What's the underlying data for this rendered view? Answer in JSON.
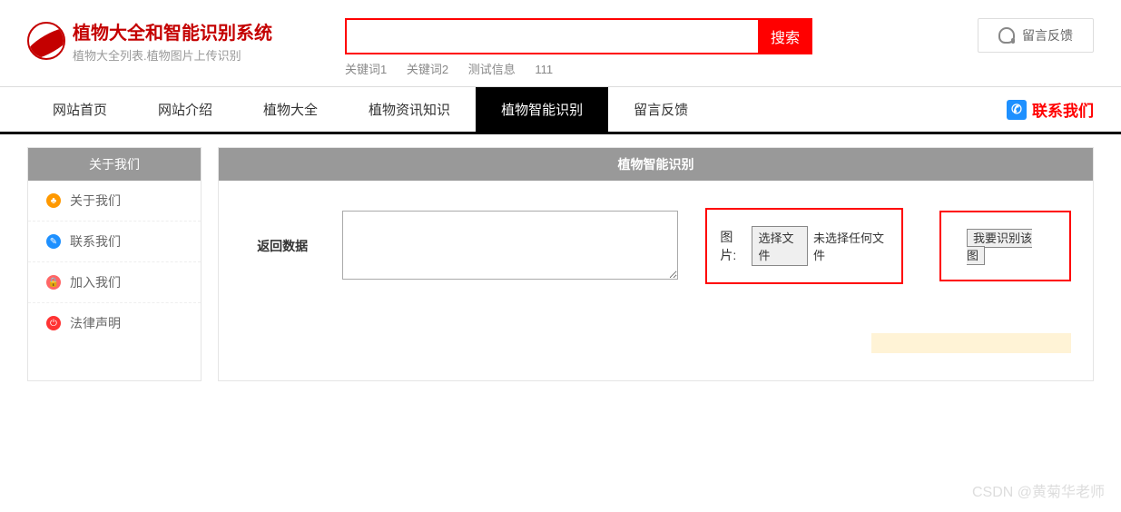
{
  "header": {
    "title": "植物大全和智能识别系统",
    "subtitle": "植物大全列表.植物图片上传识别",
    "search_button": "搜索",
    "keywords": [
      "关键词1",
      "关键词2",
      "测试信息",
      "111"
    ],
    "feedback_label": "留言反馈"
  },
  "nav": {
    "items": [
      "网站首页",
      "网站介绍",
      "植物大全",
      "植物资讯知识",
      "植物智能识别",
      "留言反馈"
    ],
    "active_index": 4,
    "contact_label": "联系我们"
  },
  "sidebar": {
    "header": "关于我们",
    "items": [
      {
        "icon": "orange",
        "glyph": "♣",
        "label": "关于我们"
      },
      {
        "icon": "blue",
        "glyph": "✎",
        "label": "联系我们"
      },
      {
        "icon": "red",
        "glyph": "🔒",
        "label": "加入我们"
      },
      {
        "icon": "red2",
        "glyph": "⏻",
        "label": "法律声明"
      }
    ]
  },
  "main": {
    "header": "植物智能识别",
    "return_label": "返回数据",
    "image_label": "图片:",
    "choose_file_label": "选择文件",
    "no_file_label": "未选择任何文件",
    "recognize_label": "我要识别该图"
  },
  "watermark": "CSDN @黄菊华老师"
}
